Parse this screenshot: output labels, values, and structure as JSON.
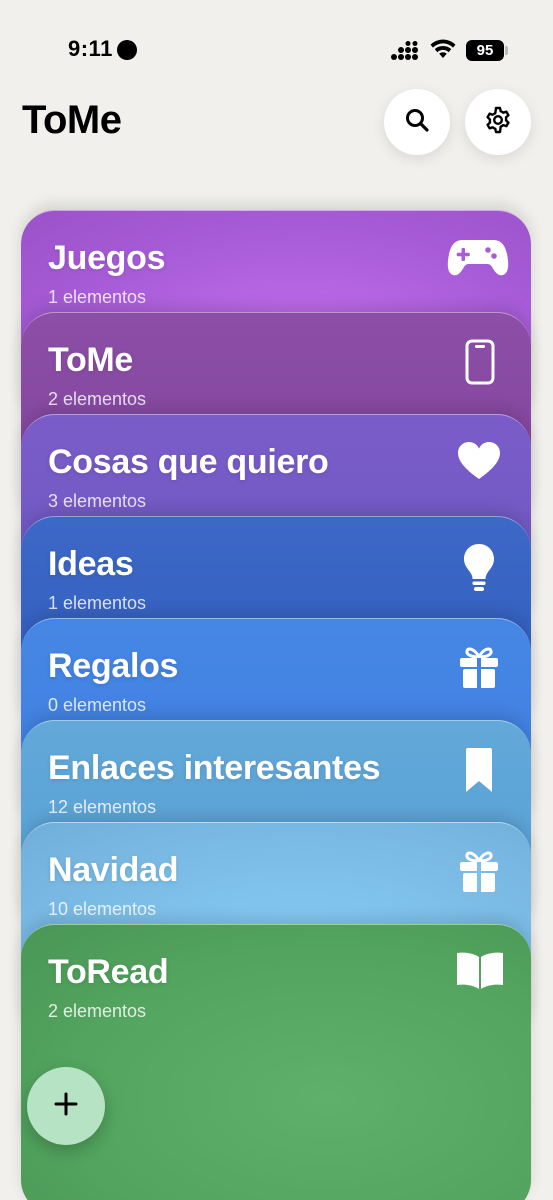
{
  "status_bar": {
    "time": "9:11",
    "battery": "95"
  },
  "header": {
    "title": "ToMe"
  },
  "lists": [
    {
      "name": "Juegos",
      "count": "1 elementos",
      "icon": "gamecontroller-icon",
      "color": "#b264e0"
    },
    {
      "name": "ToMe",
      "count": "2 elementos",
      "icon": "iphone-icon",
      "color": "#8a4aa0"
    },
    {
      "name": "Cosas que quiero",
      "count": "3 elementos",
      "icon": "heart-icon",
      "color": "#6a5ec4"
    },
    {
      "name": "Ideas",
      "count": "1 elementos",
      "icon": "lightbulb-icon",
      "color": "#3a64c8"
    },
    {
      "name": "Regalos",
      "count": "0 elementos",
      "icon": "gift-icon",
      "color": "#4284e6"
    },
    {
      "name": "Enlaces interesantes",
      "count": "12 elementos",
      "icon": "bookmark-icon",
      "color": "#5aa2d6"
    },
    {
      "name": "Navidad",
      "count": "10 elementos",
      "icon": "gift-icon",
      "color": "#7cc0ec"
    },
    {
      "name": "ToRead",
      "count": "2 elementos",
      "icon": "book-icon",
      "color": "#5aa864"
    }
  ]
}
